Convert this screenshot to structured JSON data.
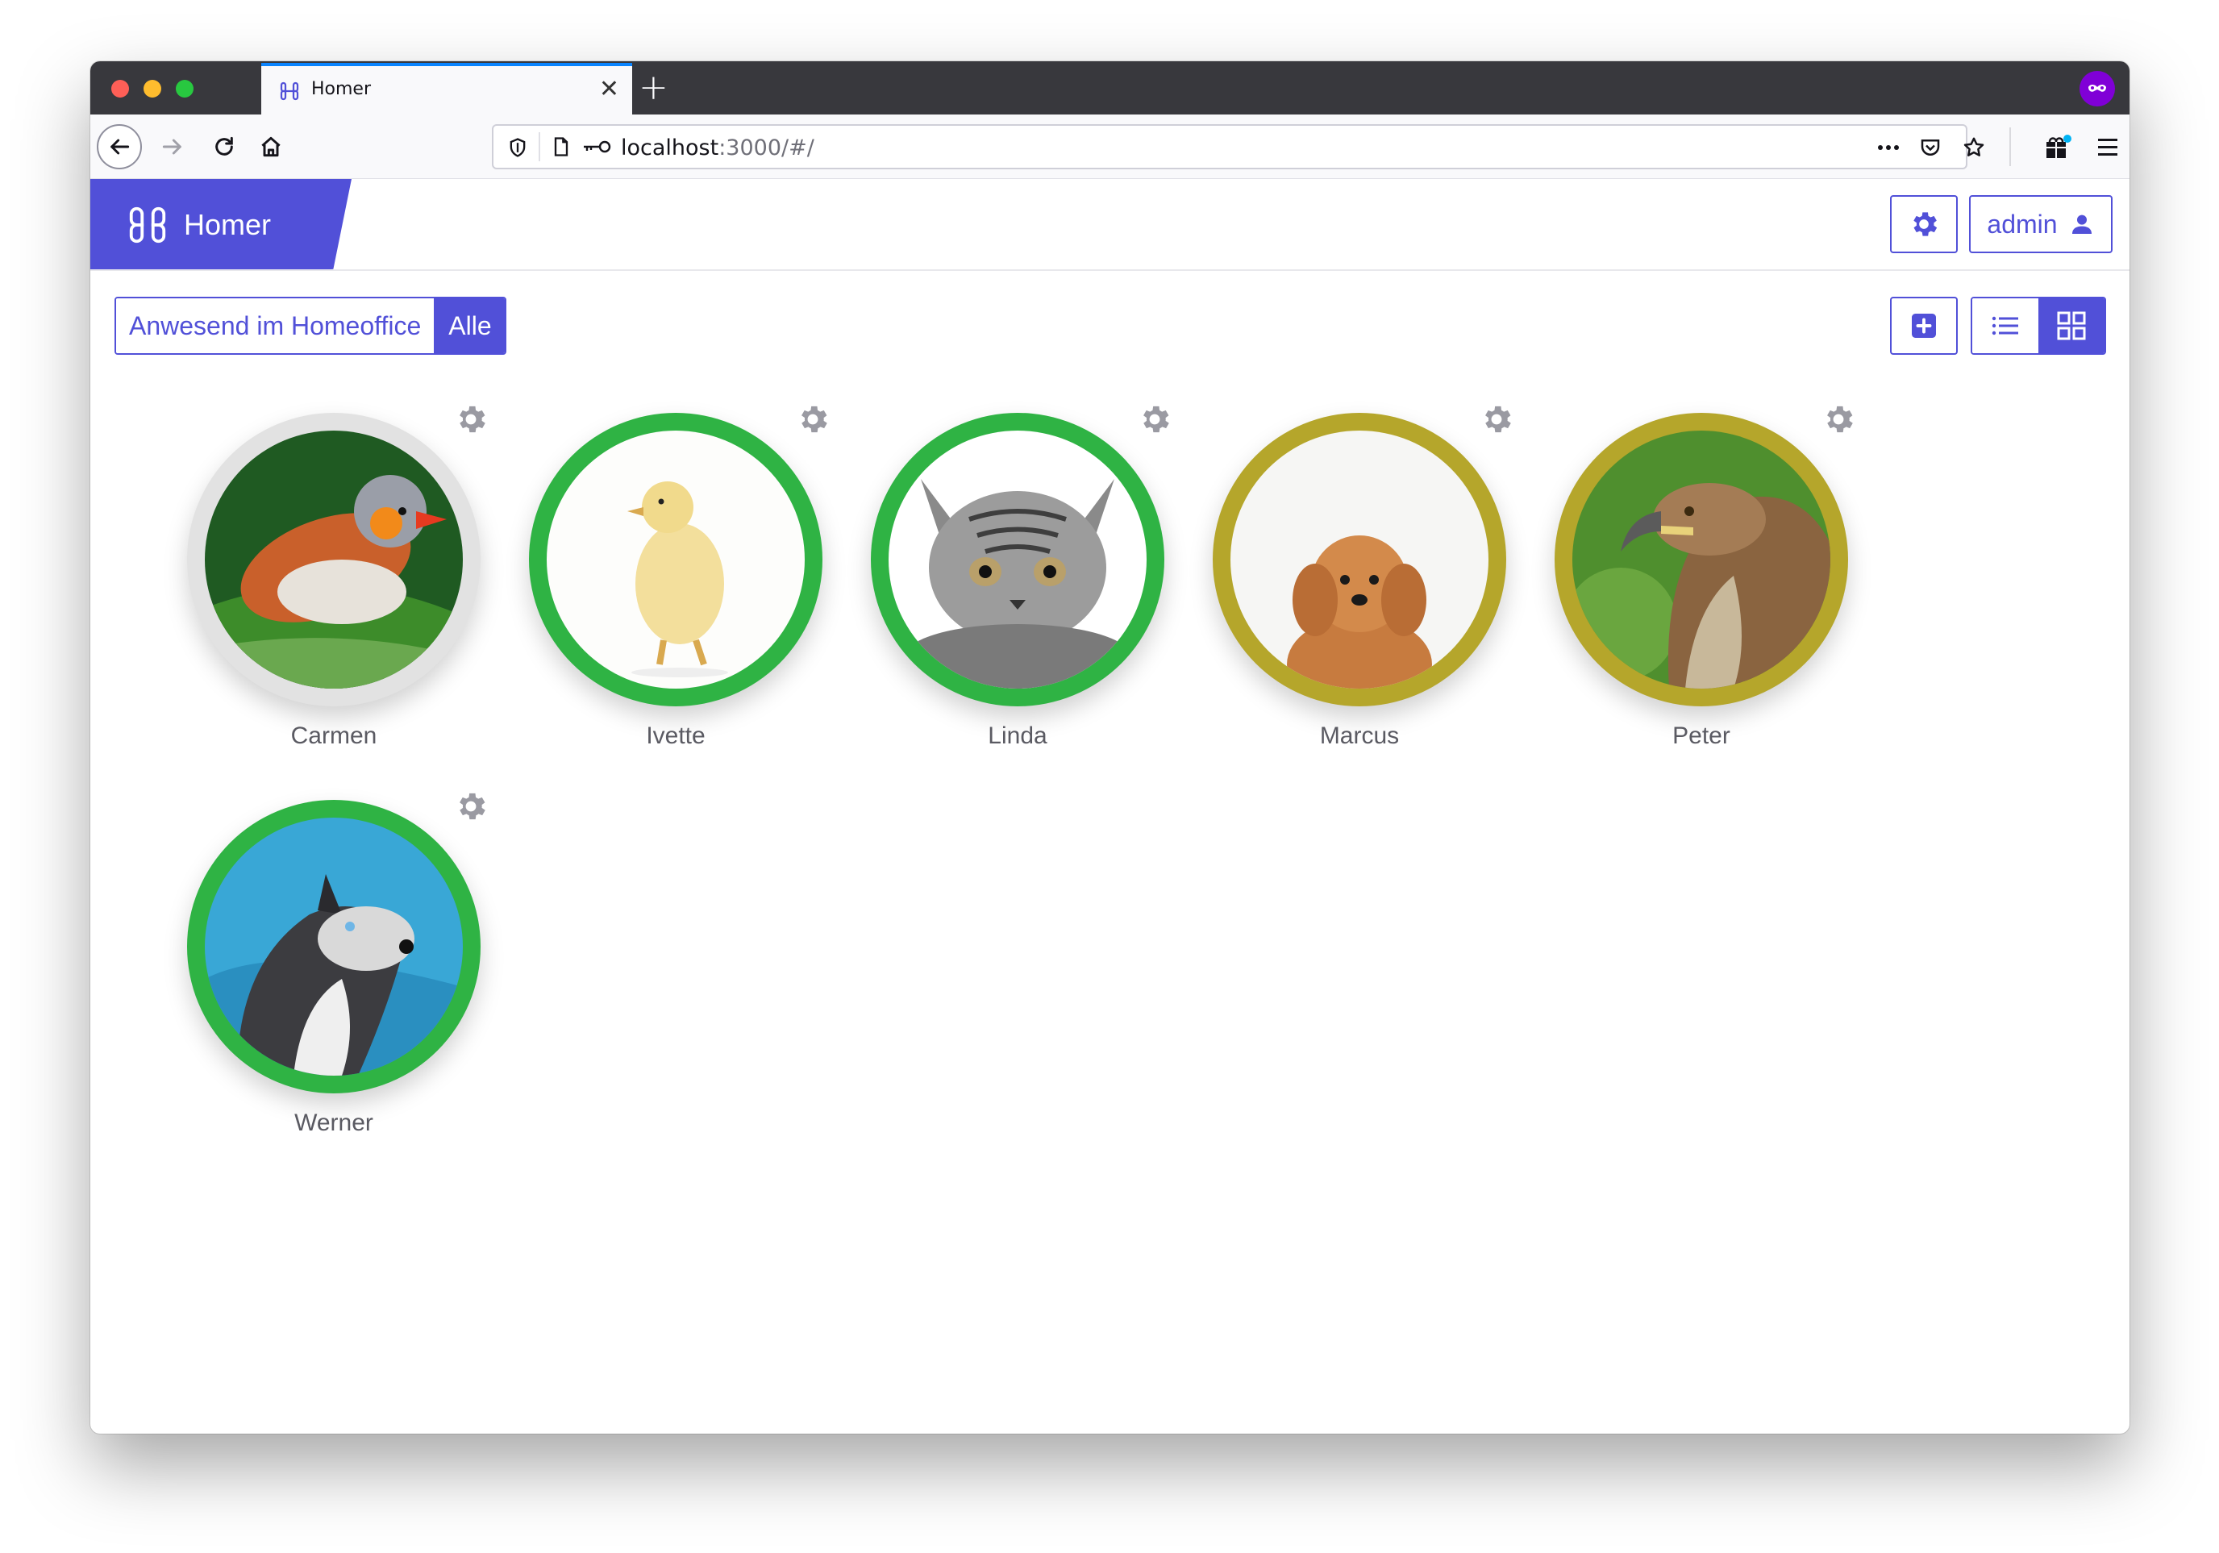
{
  "browser": {
    "tab_title": "Homer",
    "url_host": "localhost",
    "url_rest": ":3000/#/"
  },
  "app": {
    "brand": "Homer",
    "brand_color": "#5150d8",
    "user_label": "admin"
  },
  "filters": {
    "presence_label": "Anwesend im Homeoffice",
    "all_label": "Alle",
    "active": "Alle"
  },
  "view": {
    "active": "grid"
  },
  "status_colors": {
    "present": "#2fb344",
    "away": "#b5a62b",
    "unknown": "#e2e2e2"
  },
  "people": [
    {
      "name": "Carmen",
      "status": "unknown",
      "avatar": "bird-photo"
    },
    {
      "name": "Ivette",
      "status": "present",
      "avatar": "duckling-photo"
    },
    {
      "name": "Linda",
      "status": "present",
      "avatar": "cat-photo"
    },
    {
      "name": "Marcus",
      "status": "away",
      "avatar": "dog-photo"
    },
    {
      "name": "Peter",
      "status": "away",
      "avatar": "eagle-photo"
    },
    {
      "name": "Werner",
      "status": "present",
      "avatar": "husky-photo"
    }
  ]
}
